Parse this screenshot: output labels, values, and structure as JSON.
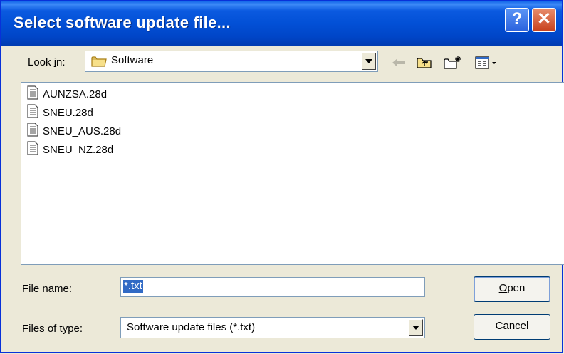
{
  "window": {
    "title": "Select software update file...",
    "help_label": "?",
    "close_label": "✕"
  },
  "lookin": {
    "label_pre": "Look ",
    "label_ul": "i",
    "label_post": "n:",
    "folder": "Software"
  },
  "files": [
    {
      "name": "AUNZSA.28d"
    },
    {
      "name": "SNEU.28d"
    },
    {
      "name": "SNEU_AUS.28d"
    },
    {
      "name": "SNEU_NZ.28d"
    }
  ],
  "filename": {
    "label_pre": "File ",
    "label_ul": "n",
    "label_post": "ame:",
    "value": "*.txt"
  },
  "filetype": {
    "label_pre": "Files of ",
    "label_ul": "t",
    "label_post": "ype:",
    "value": "Software update files (*.txt)"
  },
  "buttons": {
    "open_ul": "O",
    "open_rest": "pen",
    "cancel": "Cancel"
  },
  "icons": [
    "folder-icon",
    "back-icon",
    "up-folder-icon",
    "new-folder-icon",
    "view-menu-icon",
    "document-icon"
  ],
  "colors": {
    "titlebar": "#0055e5",
    "selection": "#316ac5",
    "window_bg": "#ece9d8"
  }
}
